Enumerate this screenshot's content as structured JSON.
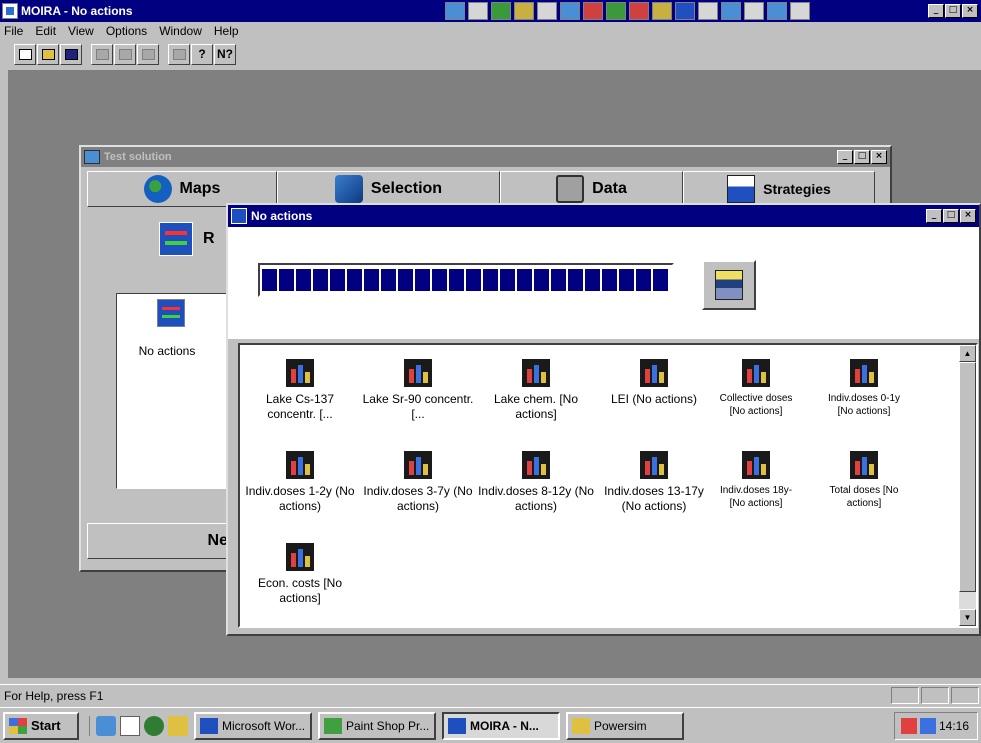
{
  "app": {
    "title": "MOIRA - No actions",
    "menu": [
      "File",
      "Edit",
      "View",
      "Options",
      "Window",
      "Help"
    ],
    "toolbar": {
      "help_label": "?",
      "context_help_label": "N?"
    }
  },
  "test_window": {
    "title": "Test solution",
    "tabs": [
      "Maps",
      "Selection",
      "Data",
      "Strategies"
    ],
    "header_text": "R",
    "list_item": "No actions",
    "footer_text": "Ne"
  },
  "na_window": {
    "title": "No actions",
    "progress_blocks": 24,
    "items": [
      {
        "label": "Lake Cs-137 concentr. [..."
      },
      {
        "label": "Lake Sr-90 concentr. [..."
      },
      {
        "label": "Lake chem. [No actions]"
      },
      {
        "label": "LEI (No actions)"
      },
      {
        "label": "Collective doses [No actions]"
      },
      {
        "label": "Indiv.doses 0-1y [No actions]"
      },
      {
        "label": "Indiv.doses 1-2y (No actions)"
      },
      {
        "label": "Indiv.doses 3-7y (No actions)"
      },
      {
        "label": "Indiv.doses 8-12y (No actions)"
      },
      {
        "label": "Indiv.doses 13-17y (No actions)"
      },
      {
        "label": "Indiv.doses 18y- [No actions]"
      },
      {
        "label": "Total doses [No actions]"
      },
      {
        "label": "Econ. costs [No actions]"
      }
    ]
  },
  "statusbar": {
    "text": "For Help, press F1"
  },
  "taskbar": {
    "start": "Start",
    "tasks": [
      "Microsoft Wor...",
      "Paint Shop Pr...",
      "MOIRA - N...",
      "Powersim"
    ],
    "clock": "14:16"
  }
}
